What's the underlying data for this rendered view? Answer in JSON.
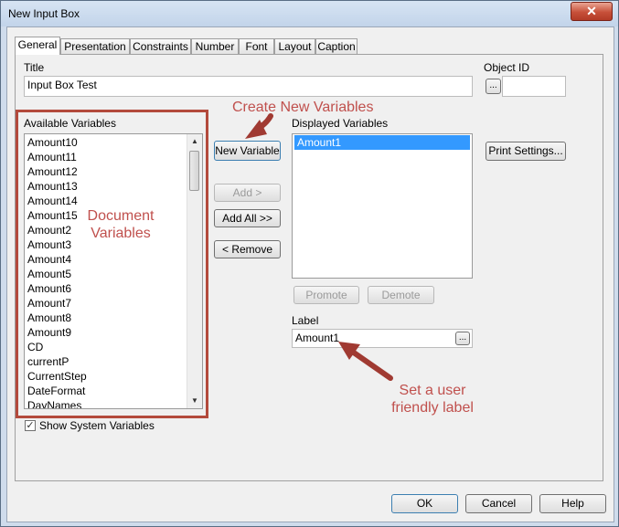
{
  "window": {
    "title": "New Input Box",
    "close_label": "✕"
  },
  "tabs": [
    {
      "label": "General"
    },
    {
      "label": "Presentation"
    },
    {
      "label": "Constraints"
    },
    {
      "label": "Number"
    },
    {
      "label": "Font"
    },
    {
      "label": "Layout"
    },
    {
      "label": "Caption"
    }
  ],
  "general": {
    "title_label": "Title",
    "title_value": "Input Box Test",
    "object_id_label": "Object ID",
    "object_id_value": "",
    "ellipsis": "...",
    "available_label": "Available Variables",
    "available_items": [
      "Amount10",
      "Amount11",
      "Amount12",
      "Amount13",
      "Amount14",
      "Amount15",
      "Amount2",
      "Amount3",
      "Amount4",
      "Amount5",
      "Amount6",
      "Amount7",
      "Amount8",
      "Amount9",
      "CD",
      "currentP",
      "CurrentStep",
      "DateFormat",
      "DayNames"
    ],
    "displayed_label": "Displayed Variables",
    "displayed_items": [
      "Amount1"
    ],
    "buttons": {
      "new_variable": "New Variable",
      "add": "Add >",
      "add_all": "Add All >>",
      "remove": "< Remove",
      "print_settings": "Print Settings...",
      "promote": "Promote",
      "demote": "Demote"
    },
    "label_caption": "Label",
    "label_value": "Amount1",
    "show_system_label": "Show System Variables",
    "show_system_checked": true,
    "check_glyph": "✓"
  },
  "annotations": {
    "create_new": "Create New Variables",
    "document_variables": "Document Variables",
    "user_label": "Set a user friendly label"
  },
  "footer": {
    "ok": "OK",
    "cancel": "Cancel",
    "help": "Help"
  },
  "colors": {
    "annotation": "#c0504d",
    "highlight": "#b34a3c",
    "selection": "#3399ff"
  }
}
